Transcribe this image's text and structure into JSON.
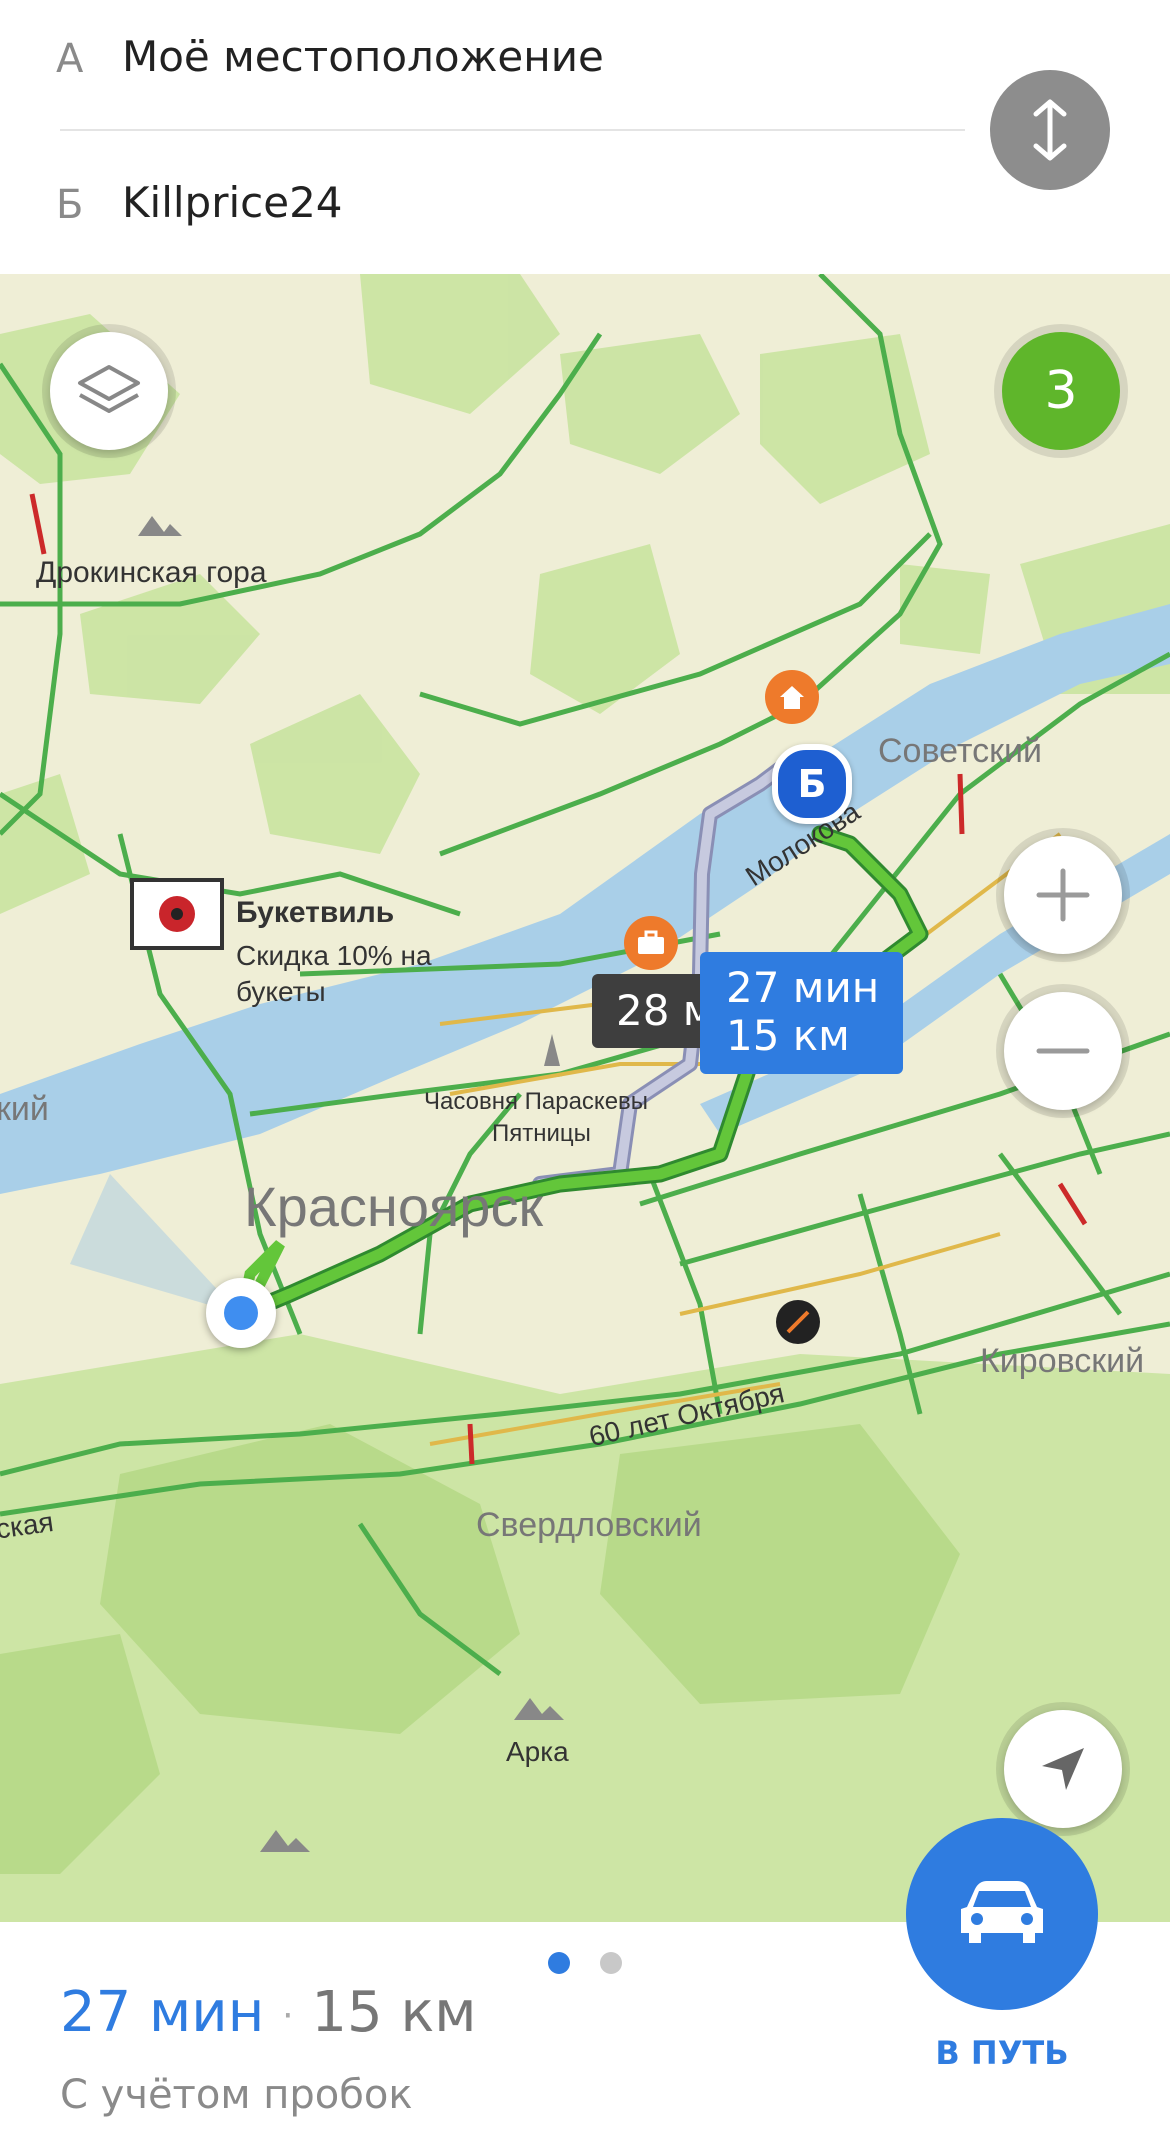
{
  "route_inputs": {
    "from_letter": "А",
    "from_text": "Моё местоположение",
    "to_letter": "Б",
    "to_text": "Killprice24"
  },
  "map": {
    "traffic_level": "3",
    "places": {
      "hill1": "Дрокинская гора",
      "ad_title": "Букетвиль",
      "ad_text_line1": "Скидка 10% на",
      "ad_text_line2": "букеты",
      "chapel_line1": "Часовня Параскевы",
      "chapel_line2": "Пятницы",
      "city": "Красноярск",
      "district_sovetsky": "Советский",
      "district_kirovsky": "Кировский",
      "district_sverdlovsky": "Свердловский",
      "district_left_partial": "кий",
      "street_molokova": "Молокова",
      "street_60let": "60 лет Октября",
      "street_partial": "ская",
      "arka": "Арка"
    },
    "route_main": {
      "time": "27 мин",
      "distance": "15 км"
    },
    "route_alt": {
      "time": "28 м"
    },
    "destination_marker": "Б"
  },
  "summary": {
    "time": "27 мин",
    "separator": "·",
    "distance": "15 км",
    "note": "С учётом пробок",
    "go_label": "В ПУТЬ"
  },
  "colors": {
    "accent": "#2f7ce0",
    "traffic_green": "#5fb62b",
    "road_green": "#4cae4c"
  }
}
